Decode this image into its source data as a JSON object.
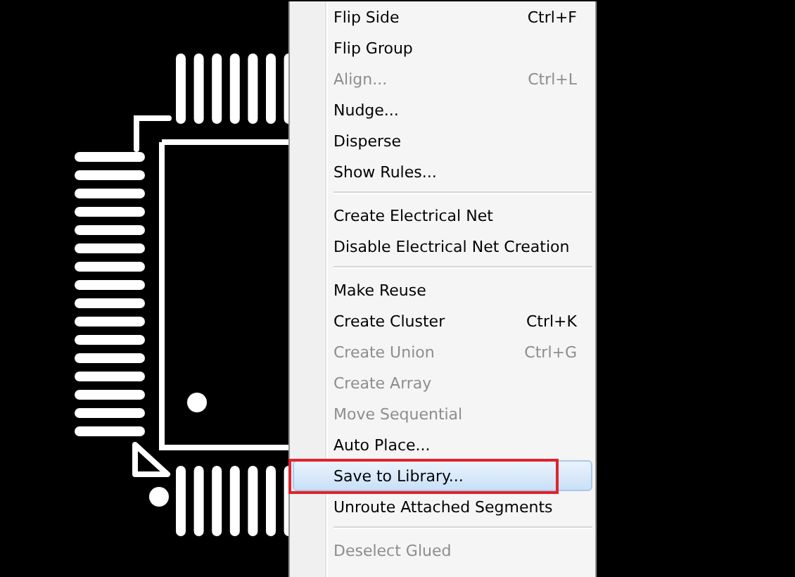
{
  "context_menu": {
    "items": [
      {
        "kind": "item",
        "label": "Flip Side",
        "shortcut": "Ctrl+F",
        "disabled": false,
        "selected": false
      },
      {
        "kind": "item",
        "label": "Flip Group",
        "disabled": false,
        "selected": false
      },
      {
        "kind": "item",
        "label": "Align...",
        "shortcut": "Ctrl+L",
        "disabled": true,
        "selected": false
      },
      {
        "kind": "item",
        "label": "Nudge...",
        "disabled": false,
        "selected": false
      },
      {
        "kind": "item",
        "label": "Disperse",
        "disabled": false,
        "selected": false
      },
      {
        "kind": "item",
        "label": "Show Rules...",
        "disabled": false,
        "selected": false
      },
      {
        "kind": "separator"
      },
      {
        "kind": "item",
        "label": "Create Electrical Net",
        "disabled": false,
        "selected": false
      },
      {
        "kind": "item",
        "label": "Disable Electrical Net Creation",
        "disabled": false,
        "selected": false
      },
      {
        "kind": "separator"
      },
      {
        "kind": "item",
        "label": "Make Reuse",
        "disabled": false,
        "selected": false
      },
      {
        "kind": "item",
        "label": "Create Cluster",
        "shortcut": "Ctrl+K",
        "disabled": false,
        "selected": false
      },
      {
        "kind": "item",
        "label": "Create Union",
        "shortcut": "Ctrl+G",
        "disabled": true,
        "selected": false
      },
      {
        "kind": "item",
        "label": "Create Array",
        "disabled": true,
        "selected": false
      },
      {
        "kind": "item",
        "label": "Move Sequential",
        "disabled": true,
        "selected": false
      },
      {
        "kind": "item",
        "label": "Auto Place...",
        "disabled": false,
        "selected": false
      },
      {
        "kind": "item",
        "label": "Save to Library...",
        "disabled": false,
        "selected": true,
        "annotated": true
      },
      {
        "kind": "item",
        "label": "Unroute Attached Segments",
        "disabled": false,
        "selected": false
      },
      {
        "kind": "separator"
      },
      {
        "kind": "item",
        "label": "Deselect Glued",
        "disabled": true,
        "selected": false
      }
    ]
  }
}
